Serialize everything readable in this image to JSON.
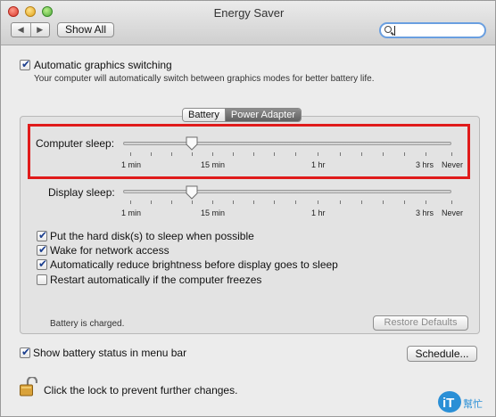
{
  "window": {
    "title": "Energy Saver"
  },
  "toolbar": {
    "back": "◀",
    "forward": "▶",
    "show_all": "Show All",
    "search_value": ""
  },
  "graphics_switching": {
    "label": "Automatic graphics switching",
    "checked": true,
    "description": "Your computer will automatically switch between graphics modes for better battery life."
  },
  "tabs": [
    {
      "label": "Battery",
      "selected": false
    },
    {
      "label": "Power Adapter",
      "selected": true
    }
  ],
  "computer_sleep": {
    "label": "Computer sleep:",
    "value": "15 min",
    "ticks": [
      "1 min",
      "15 min",
      "1 hr",
      "3 hrs",
      "Never"
    ]
  },
  "display_sleep": {
    "label": "Display sleep:",
    "value": "15 min",
    "ticks": [
      "1 min",
      "15 min",
      "1 hr",
      "3 hrs",
      "Never"
    ]
  },
  "options": [
    {
      "label": "Put the hard disk(s) to sleep when possible",
      "checked": true
    },
    {
      "label": "Wake for network access",
      "checked": true
    },
    {
      "label": "Automatically reduce brightness before display goes to sleep",
      "checked": true
    },
    {
      "label": "Restart automatically if the computer freezes",
      "checked": false
    }
  ],
  "battery_status": "Battery is charged.",
  "restore_defaults": "Restore Defaults",
  "menu_bar": {
    "label": "Show battery status in menu bar",
    "checked": true
  },
  "schedule": "Schedule...",
  "lock_text": "Click the lock to prevent further changes.",
  "watermark": {
    "brand": "iT",
    "text": "幫忙"
  },
  "colors": {
    "highlight": "#e01b1b",
    "checkmark": "#1b3e8e",
    "search_focus": "#6a9fe0"
  }
}
